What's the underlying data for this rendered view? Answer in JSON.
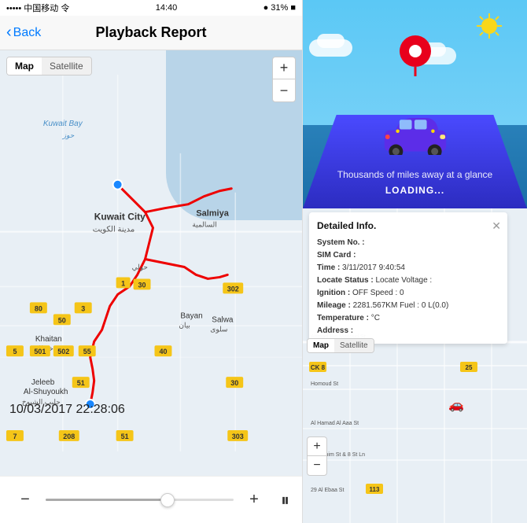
{
  "statusBar": {
    "leftText": "••••• 中国移动 令",
    "time": "14:40",
    "rightText": "● 31% ■"
  },
  "header": {
    "backLabel": "Back",
    "title": "Playback Report"
  },
  "mapTypeSelector": {
    "options": [
      "Map",
      "Satellite"
    ]
  },
  "zoomButtons": {
    "plus": "+",
    "minus": "−"
  },
  "timestamp": "10/03/2017 22:28:06",
  "controls": {
    "minus": "−",
    "plus": "+",
    "pause": "⏸"
  },
  "illustration": {
    "tagline": "Thousands of miles away at a glance",
    "loading": "LOADING..."
  },
  "detailPopup": {
    "title": "Detailed Info.",
    "fields": [
      {
        "label": "System No. :",
        "value": ""
      },
      {
        "label": "SIM Card :",
        "value": ""
      },
      {
        "label": "Time :",
        "value": "3/11/2017 9:40:54"
      },
      {
        "label": "Locate Status :",
        "value": "Locate Voltage :"
      },
      {
        "label": "Ignition :",
        "value": "OFF Speed : 0"
      },
      {
        "label": "Mileage :",
        "value": "2281.567KM Fuel : 0 L(0.0)"
      },
      {
        "label": "Temperature :",
        "value": "°C"
      },
      {
        "label": "Address :",
        "value": ""
      }
    ]
  },
  "rightMapType": {
    "options": [
      "Map",
      "Satellite"
    ]
  }
}
